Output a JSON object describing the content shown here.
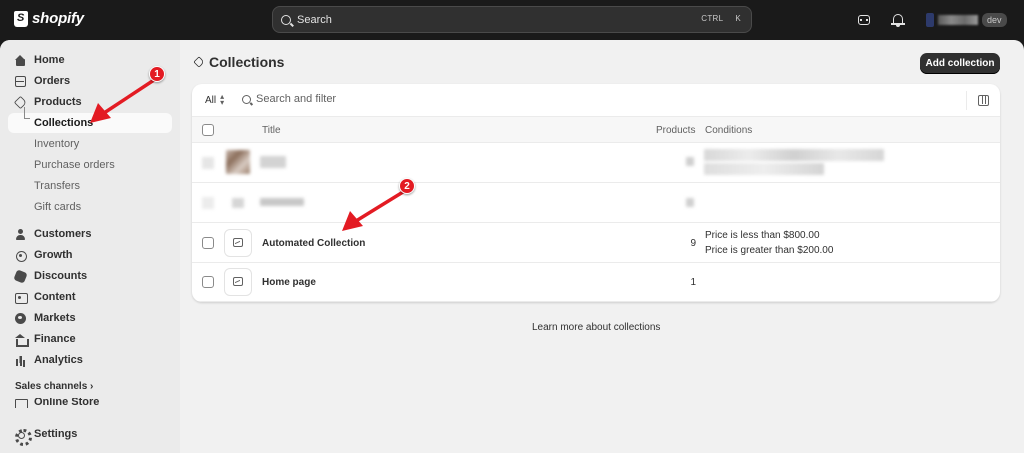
{
  "topbar": {
    "brand": "shopify",
    "search_placeholder": "Search",
    "shortcut_ctrl": "CTRL",
    "shortcut_key": "K",
    "store_badge": "dev"
  },
  "sidebar": {
    "items": [
      {
        "label": "Home",
        "icon": "home-icon"
      },
      {
        "label": "Orders",
        "icon": "orders-icon"
      },
      {
        "label": "Products",
        "icon": "tag-icon"
      }
    ],
    "product_subitems": [
      "Collections",
      "Inventory",
      "Purchase orders",
      "Transfers",
      "Gift cards"
    ],
    "active_subitem": "Collections",
    "items2": [
      {
        "label": "Customers",
        "icon": "person-icon"
      },
      {
        "label": "Growth",
        "icon": "growth-icon"
      },
      {
        "label": "Discounts",
        "icon": "discount-icon"
      },
      {
        "label": "Content",
        "icon": "content-icon"
      },
      {
        "label": "Markets",
        "icon": "globe-icon"
      },
      {
        "label": "Finance",
        "icon": "bank-icon"
      },
      {
        "label": "Analytics",
        "icon": "bar-chart-icon"
      }
    ],
    "sales_channels": "Sales channels",
    "online_store": "Online Store",
    "settings": "Settings"
  },
  "page": {
    "title": "Collections",
    "add_button": "Add collection",
    "filter_all": "All",
    "filter_placeholder": "Search and filter",
    "columns": {
      "title": "Title",
      "products": "Products",
      "conditions": "Conditions"
    },
    "rows": [
      {
        "title": "Automated Collection",
        "products": "9",
        "conditions": [
          "Price is less than $800.00",
          "Price is greater than $200.00"
        ]
      },
      {
        "title": "Home page",
        "products": "1",
        "conditions": []
      }
    ],
    "learn_more": "Learn more about collections"
  },
  "annotations": {
    "marker1": "1",
    "marker2": "2",
    "color": "#e31b23"
  }
}
